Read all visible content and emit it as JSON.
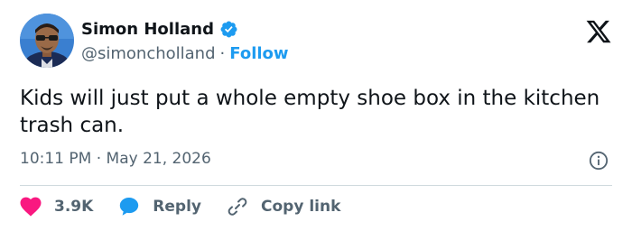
{
  "author": {
    "display_name": "Simon Holland",
    "handle": "@simoncholland",
    "separator": "·",
    "follow_label": "Follow",
    "verified": true
  },
  "tweet": {
    "text": "Kids will just put a whole empty shoe box in the kitchen trash can.",
    "timestamp": "10:11 PM · May 21, 2026"
  },
  "actions": {
    "likes": "3.9K",
    "reply_label": "Reply",
    "copy_label": "Copy link"
  },
  "colors": {
    "accent": "#1d9bf0",
    "like": "#f91880",
    "text_primary": "#0f1419",
    "text_secondary": "#536471"
  },
  "icons": {
    "brand": "x-logo-icon",
    "verified": "verified-badge-icon",
    "info": "info-icon",
    "like": "heart-icon",
    "reply": "reply-bubble-icon",
    "copy": "link-icon"
  }
}
